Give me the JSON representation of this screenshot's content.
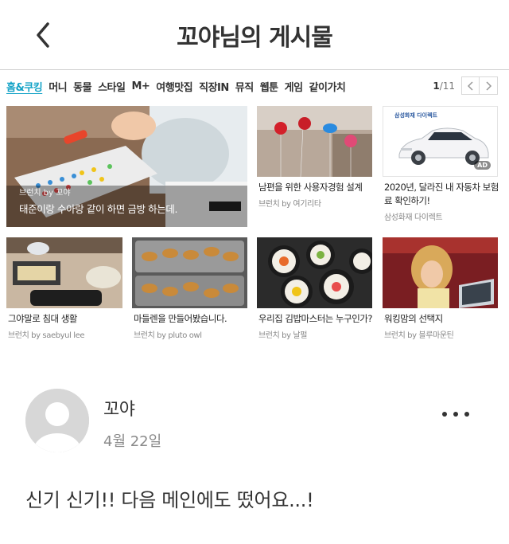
{
  "header": {
    "title": "꼬야님의 게시물"
  },
  "categories": {
    "items": [
      "홈&쿠킹",
      "머니",
      "동물",
      "스타일",
      "M+",
      "여행맛집",
      "직장IN",
      "뮤직",
      "웹툰",
      "게임",
      "같이가치"
    ],
    "active": "홈&쿠킹"
  },
  "pager": {
    "current": "1",
    "total": "/11",
    "prev_icon": "chevron-left-icon",
    "next_icon": "chevron-right-icon"
  },
  "featured": {
    "source": "브런치 by 꼬야",
    "title": "태준이랑 수아랑 같이 하면 금방 하는데."
  },
  "cards": [
    {
      "title": "남편을 위한 사용자경험 설계",
      "source": "브런치 by 여기리타"
    },
    {
      "title": "2020년, 달라진 내 자동차 보험료 확인하기!",
      "source": "삼성화재 다이렉트",
      "ad": "AD",
      "brand": "삼성화재 다이렉트"
    },
    {
      "title": "그야말로 침대 생활",
      "source": "브런치 by saebyul lee"
    },
    {
      "title": "마들렌을 만들어봤습니다.",
      "source": "브런치 by pluto owl"
    },
    {
      "title": "우리집 김밥마스터는 누구인가?",
      "source": "브런치 by 날펄"
    },
    {
      "title": "워킹맘의 선택지",
      "source": "브런치 by 블루마운틴"
    }
  ],
  "post": {
    "author": "꼬야",
    "date": "4월 22일",
    "comment": "신기 신기!! 다음 메인에도 떴어요...!"
  },
  "colors": {
    "accent": "#14a3c7"
  }
}
